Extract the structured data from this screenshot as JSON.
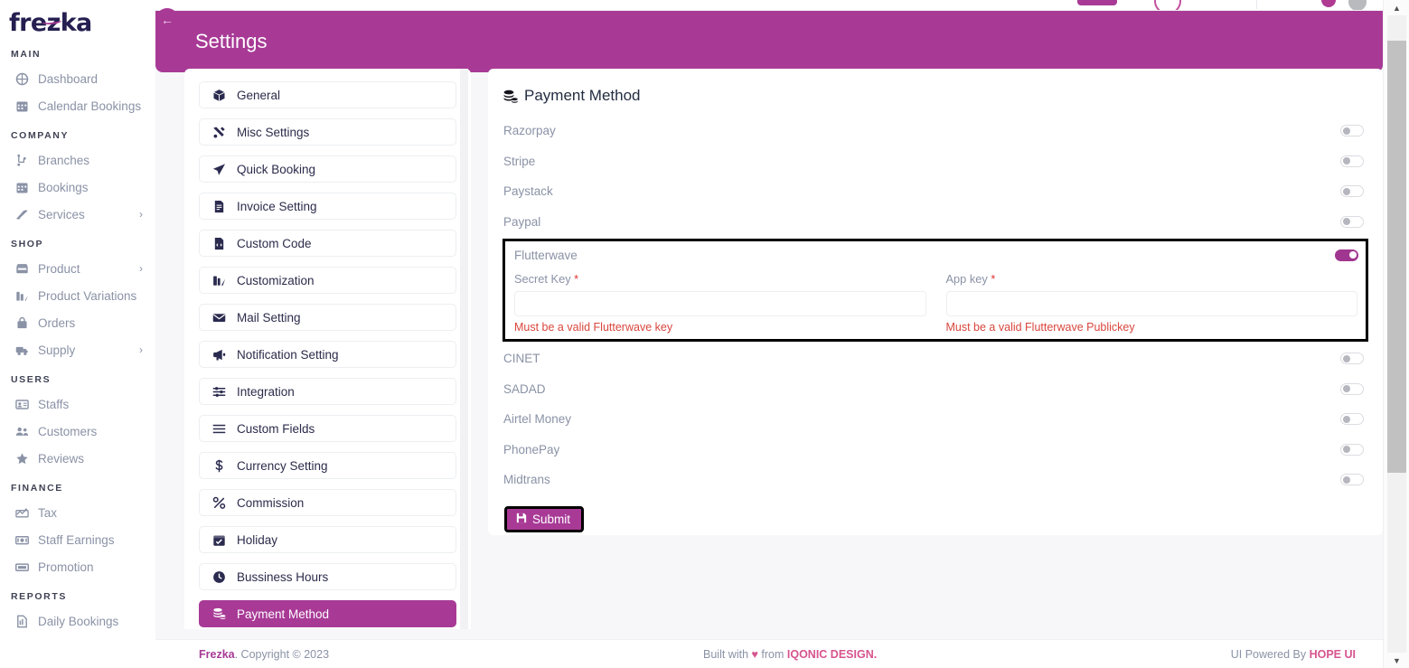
{
  "brand": {
    "name": "frezka"
  },
  "sidebar": {
    "sections": [
      {
        "title": "MAIN",
        "items": [
          {
            "label": "Dashboard",
            "icon": "dashboard-icon",
            "chevron": false
          },
          {
            "label": "Calendar Bookings",
            "icon": "calendar-icon",
            "chevron": false
          }
        ]
      },
      {
        "title": "COMPANY",
        "items": [
          {
            "label": "Branches",
            "icon": "branch-icon",
            "chevron": false
          },
          {
            "label": "Bookings",
            "icon": "calendar-icon",
            "chevron": false
          },
          {
            "label": "Services",
            "icon": "services-icon",
            "chevron": true
          }
        ]
      },
      {
        "title": "SHOP",
        "items": [
          {
            "label": "Product",
            "icon": "product-icon",
            "chevron": true
          },
          {
            "label": "Product Variations",
            "icon": "variations-icon",
            "chevron": false
          },
          {
            "label": "Orders",
            "icon": "bag-icon",
            "chevron": false
          },
          {
            "label": "Supply",
            "icon": "truck-icon",
            "chevron": true
          }
        ]
      },
      {
        "title": "USERS",
        "items": [
          {
            "label": "Staffs",
            "icon": "id-card-icon",
            "chevron": false
          },
          {
            "label": "Customers",
            "icon": "people-icon",
            "chevron": false
          },
          {
            "label": "Reviews",
            "icon": "star-icon",
            "chevron": false
          }
        ]
      },
      {
        "title": "FINANCE",
        "items": [
          {
            "label": "Tax",
            "icon": "tax-icon",
            "chevron": false
          },
          {
            "label": "Staff Earnings",
            "icon": "money-icon",
            "chevron": false
          },
          {
            "label": "Promotion",
            "icon": "ticket-icon",
            "chevron": false
          }
        ]
      },
      {
        "title": "REPORTS",
        "items": [
          {
            "label": "Daily Bookings",
            "icon": "report-icon",
            "chevron": false
          }
        ]
      }
    ]
  },
  "header": {
    "title": "Settings",
    "back_icon": "arrow-left-icon"
  },
  "settings_menu": {
    "items": [
      {
        "label": "General",
        "icon": "box-icon",
        "active": false
      },
      {
        "label": "Misc Settings",
        "icon": "tools-icon",
        "active": false
      },
      {
        "label": "Quick Booking",
        "icon": "send-icon",
        "active": false
      },
      {
        "label": "Invoice Setting",
        "icon": "invoice-icon",
        "active": false
      },
      {
        "label": "Custom Code",
        "icon": "code-file-icon",
        "active": false
      },
      {
        "label": "Customization",
        "icon": "customization-icon",
        "active": false
      },
      {
        "label": "Mail Setting",
        "icon": "mail-icon",
        "active": false
      },
      {
        "label": "Notification Setting",
        "icon": "megaphone-icon",
        "active": false
      },
      {
        "label": "Integration",
        "icon": "sliders-icon",
        "active": false
      },
      {
        "label": "Custom Fields",
        "icon": "list-icon",
        "active": false
      },
      {
        "label": "Currency Setting",
        "icon": "dollar-icon",
        "active": false
      },
      {
        "label": "Commission",
        "icon": "percent-icon",
        "active": false
      },
      {
        "label": "Holiday",
        "icon": "holiday-icon",
        "active": false
      },
      {
        "label": "Bussiness Hours",
        "icon": "clock-icon",
        "active": false
      },
      {
        "label": "Payment Method",
        "icon": "coins-icon",
        "active": true
      }
    ]
  },
  "payment_card": {
    "title": "Payment Method",
    "title_icon": "coins-icon",
    "methods_before": [
      {
        "label": "Razorpay",
        "enabled": false
      },
      {
        "label": "Stripe",
        "enabled": false
      },
      {
        "label": "Paystack",
        "enabled": false
      },
      {
        "label": "Paypal",
        "enabled": false
      }
    ],
    "flutterwave": {
      "label": "Flutterwave",
      "enabled": true,
      "fields": [
        {
          "label": "Secret Key",
          "required_mark": "*",
          "value": "",
          "placeholder": "",
          "error": "Must be a valid Flutterwave key"
        },
        {
          "label": "App key",
          "required_mark": "*",
          "value": "",
          "placeholder": "",
          "error": "Must be a valid Flutterwave Publickey"
        }
      ]
    },
    "methods_after": [
      {
        "label": "CINET",
        "enabled": false
      },
      {
        "label": "SADAD",
        "enabled": false
      },
      {
        "label": "Airtel Money",
        "enabled": false
      },
      {
        "label": "PhonePay",
        "enabled": false
      },
      {
        "label": "Midtrans",
        "enabled": false
      }
    ],
    "submit": {
      "label": "Submit",
      "icon": "save-icon"
    }
  },
  "footer": {
    "left_brand": "Frezka",
    "left_text": ". Copyright © 2023",
    "mid_prefix": "Built with ",
    "mid_heart": "♥",
    "mid_from": " from ",
    "mid_link": "IQONIC DESIGN.",
    "right_prefix": "UI Powered By ",
    "right_link": "HOPE UI"
  },
  "colors": {
    "accent": "#a83a96",
    "toggle_on": "#a0368f",
    "error": "#d9463d",
    "sidebar_text": "#8a92a6",
    "heading": "#232d42",
    "focus_outline": "#000000"
  }
}
